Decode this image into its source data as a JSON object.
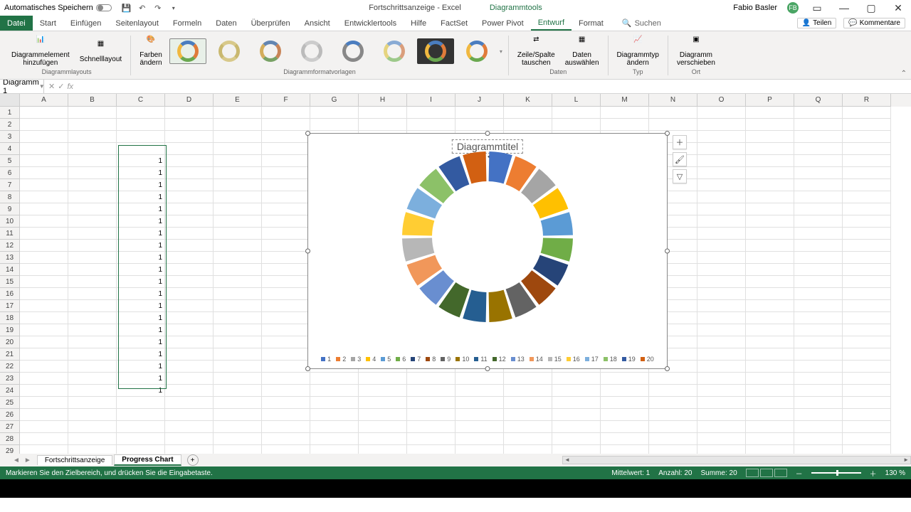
{
  "titlebar": {
    "autosave": "Automatisches Speichern",
    "doc": "Fortschrittsanzeige  -  Excel",
    "tool": "Diagrammtools",
    "user": "Fabio Basler",
    "badge": "FB"
  },
  "tabs": {
    "file": "Datei",
    "items": [
      "Start",
      "Einfügen",
      "Seitenlayout",
      "Formeln",
      "Daten",
      "Überprüfen",
      "Ansicht",
      "Entwicklertools",
      "Hilfe",
      "FactSet",
      "Power Pivot",
      "Entwurf",
      "Format"
    ],
    "active": "Entwurf",
    "search": "Suchen",
    "share": "Teilen",
    "comments": "Kommentare"
  },
  "ribbon": {
    "g1_a": "Diagrammelement\nhinzufügen",
    "g1_b": "Schnelllayout",
    "g1_label": "Diagrammlayouts",
    "g2_a": "Farben\nändern",
    "g2_label": "Diagrammformatvorlagen",
    "g3_a": "Zeile/Spalte\ntauschen",
    "g3_b": "Daten\nauswählen",
    "g3_label": "Daten",
    "g4_a": "Diagrammtyp\nändern",
    "g4_label": "Typ",
    "g5_a": "Diagramm\nverschieben",
    "g5_label": "Ort"
  },
  "namebox": "Diagramm 1",
  "columns": [
    "A",
    "B",
    "C",
    "D",
    "E",
    "F",
    "G",
    "H",
    "I",
    "J",
    "K",
    "L",
    "M",
    "N",
    "O",
    "P",
    "Q",
    "R"
  ],
  "rows": [
    1,
    2,
    3,
    4,
    5,
    6,
    7,
    8,
    9,
    10,
    11,
    12,
    13,
    14,
    15,
    16,
    17,
    18,
    19,
    20,
    21,
    22,
    23,
    24,
    25,
    26,
    27,
    28,
    29
  ],
  "data_c": {
    "5": 1,
    "6": 1,
    "7": 1,
    "8": 1,
    "9": 1,
    "10": 1,
    "11": 1,
    "12": 1,
    "13": 1,
    "14": 1,
    "15": 1,
    "16": 1,
    "17": 1,
    "18": 1,
    "19": 1,
    "20": 1,
    "21": 1,
    "22": 1,
    "23": 1,
    "24": 1
  },
  "chart": {
    "title": "Diagrammtitel",
    "legend": [
      "1",
      "2",
      "3",
      "4",
      "5",
      "6",
      "7",
      "8",
      "9",
      "10",
      "11",
      "12",
      "13",
      "14",
      "15",
      "16",
      "17",
      "18",
      "19",
      "20"
    ],
    "colors": [
      "#4472c4",
      "#ed7d31",
      "#a5a5a5",
      "#ffc000",
      "#5b9bd5",
      "#70ad47",
      "#264478",
      "#9e480e",
      "#636363",
      "#997300",
      "#255e91",
      "#43682b",
      "#698ed0",
      "#f1975a",
      "#b7b7b7",
      "#ffcd33",
      "#7cafdd",
      "#8cc168",
      "#335aa1",
      "#d26012"
    ]
  },
  "chart_data": {
    "type": "pie",
    "categories": [
      "1",
      "2",
      "3",
      "4",
      "5",
      "6",
      "7",
      "8",
      "9",
      "10",
      "11",
      "12",
      "13",
      "14",
      "15",
      "16",
      "17",
      "18",
      "19",
      "20"
    ],
    "values": [
      1,
      1,
      1,
      1,
      1,
      1,
      1,
      1,
      1,
      1,
      1,
      1,
      1,
      1,
      1,
      1,
      1,
      1,
      1,
      1
    ],
    "title": "Diagrammtitel",
    "subtype": "doughnut"
  },
  "sheets": {
    "a": "Fortschrittsanzeige",
    "b": "Progress Chart"
  },
  "status": {
    "msg": "Markieren Sie den Zielbereich, und drücken Sie die Eingabetaste.",
    "avg": "Mittelwert: 1",
    "count": "Anzahl: 20",
    "sum": "Summe: 20",
    "zoom": "130 %"
  }
}
